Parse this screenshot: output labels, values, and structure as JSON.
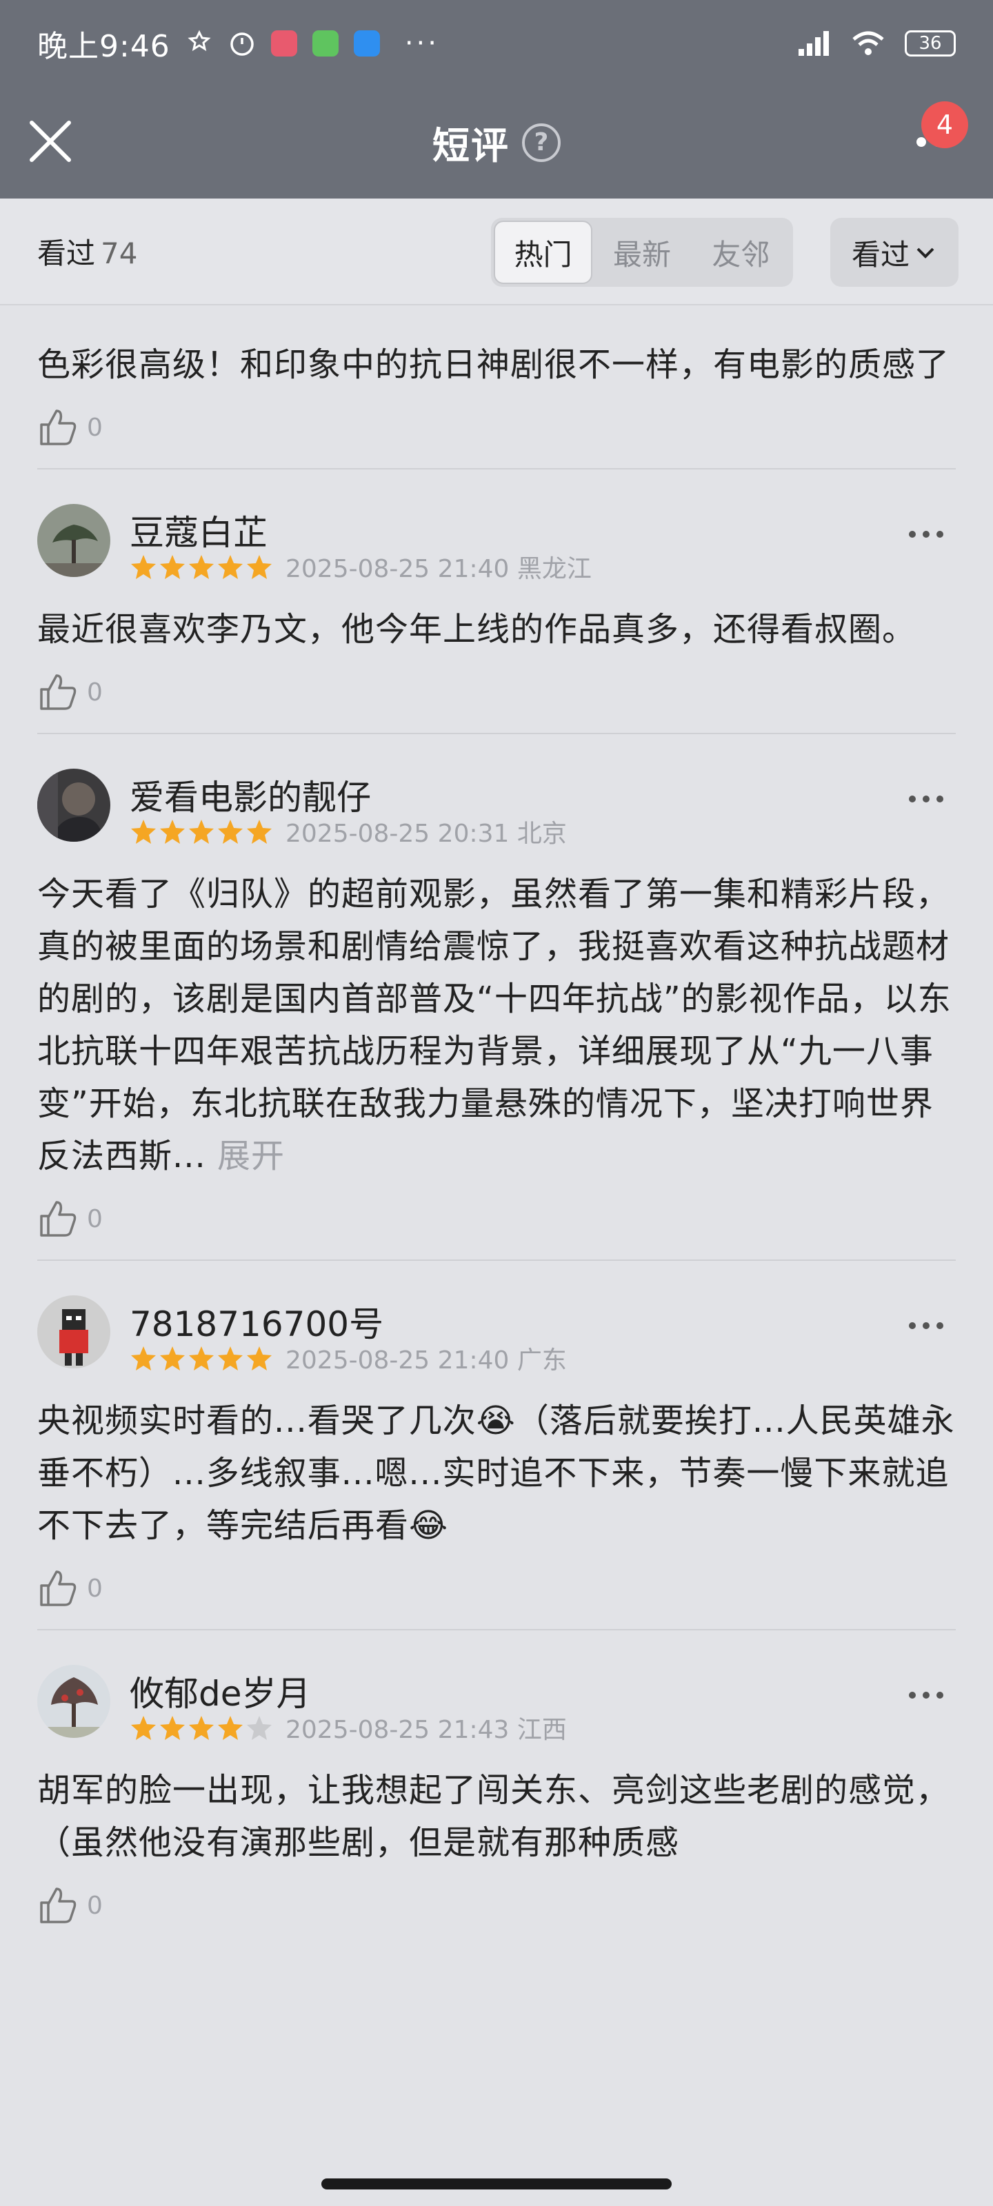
{
  "status_bar": {
    "time": "晚上9:46",
    "battery": "36"
  },
  "nav": {
    "title": "短评",
    "help": "?",
    "badge": "4"
  },
  "filter": {
    "seen_label": "看过",
    "seen_count": "74",
    "tabs": [
      "热门",
      "最新",
      "友邻"
    ],
    "sort_label": "看过"
  },
  "comments": [
    {
      "text": "色彩很高级！和印象中的抗日神剧很不一样，有电影的质感了",
      "likes": "0"
    },
    {
      "name": "豆蔻白芷",
      "rating": 5,
      "time": "2025-08-25 21:40 黑龙江",
      "text": "最近很喜欢李乃文，他今年上线的作品真多，还得看叔圈。",
      "likes": "0"
    },
    {
      "name": "爱看电影的靓仔",
      "rating": 5,
      "time": "2025-08-25 20:31 北京",
      "text": "今天看了《归队》的超前观影，虽然看了第一集和精彩片段，真的被里面的场景和剧情给震惊了，我挺喜欢看这种抗战题材的剧的，该剧是国内首部普及“十四年抗战”的影视作品，以东北抗联十四年艰苦抗战历程为背景，详细展现了从“九一八事变”开始，东北抗联在敌我力量悬殊的情况下，坚决打响世界反法西斯...",
      "expand": "展开",
      "likes": "0"
    },
    {
      "name": "7818716700号",
      "rating": 5,
      "time": "2025-08-25 21:40 广东",
      "text": "央视频实时看的...看哭了几次😭（落后就要挨打...人民英雄永垂不朽）...多线叙事...嗯...实时追不下来，节奏一慢下来就追不下去了，等完结后再看😂",
      "likes": "0"
    },
    {
      "name": "攸郁de岁月",
      "rating": 4,
      "time": "2025-08-25 21:43 江西",
      "text": "胡军的脸一出现，让我想起了闯关东、亮剑这些老剧的感觉，（虽然他没有演那些剧，但是就有那种质感",
      "likes": "0"
    }
  ],
  "colors": {
    "star": "#f5a623",
    "nav_bg": "#6b6f78",
    "badge": "#ee5656"
  }
}
